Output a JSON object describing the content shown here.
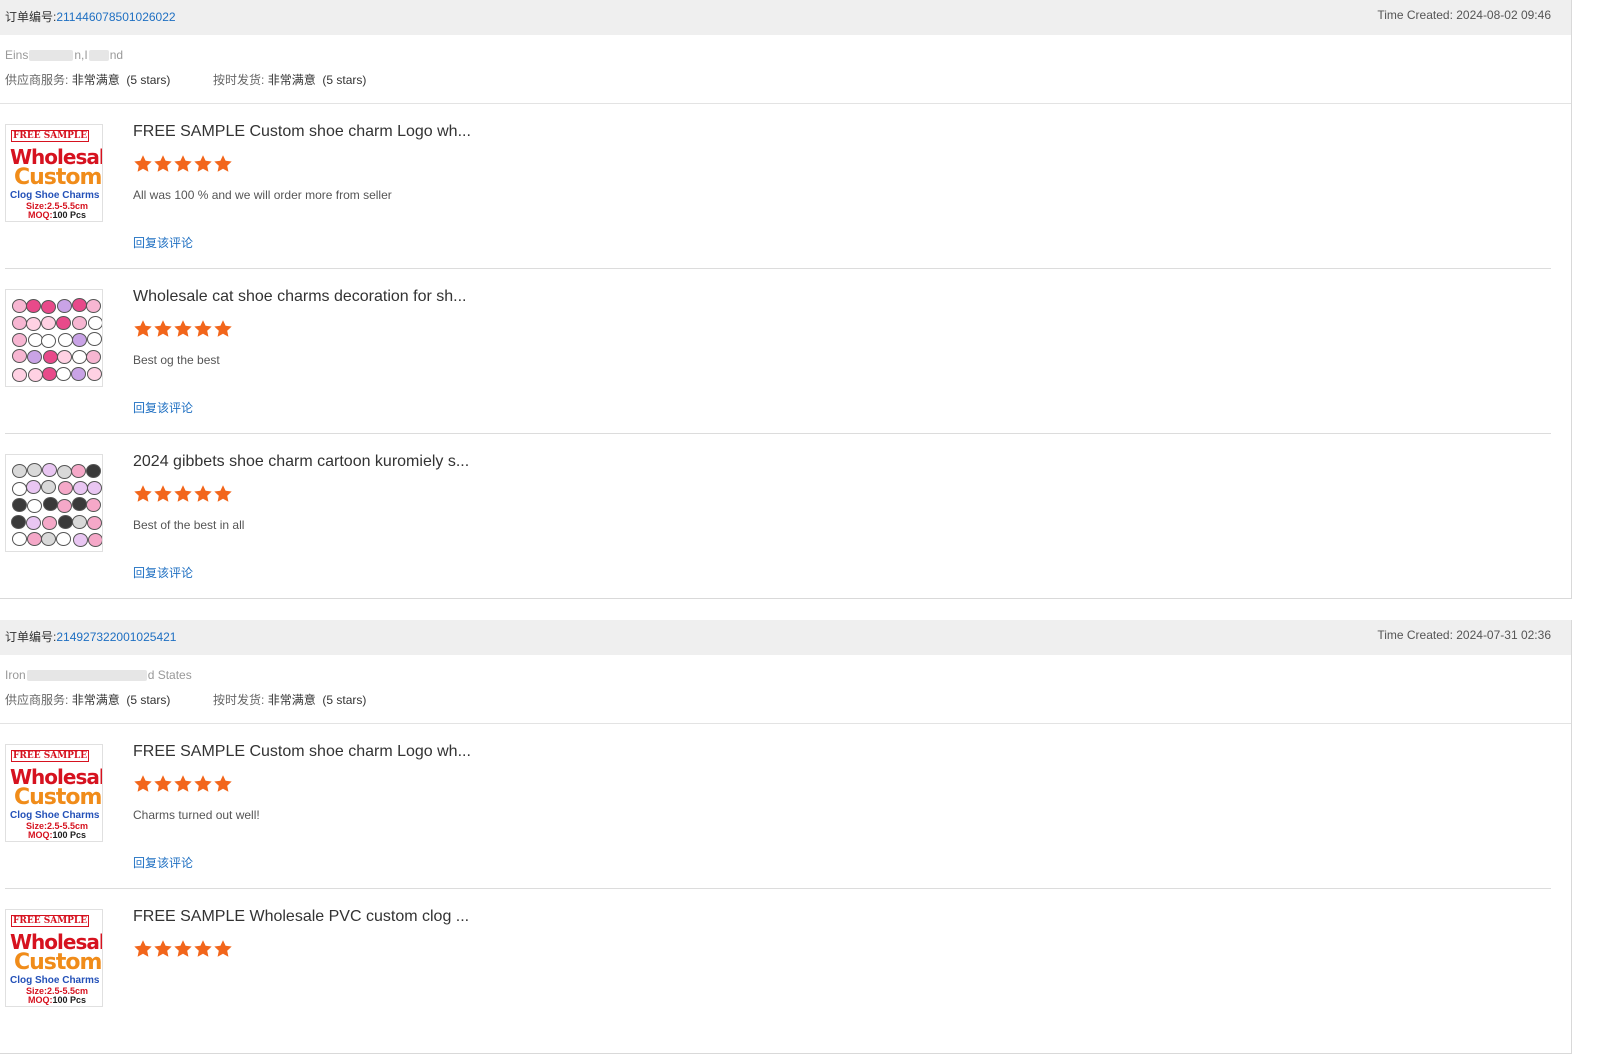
{
  "orders": [
    {
      "order_label": "订单编号:",
      "order_no": "211446078501026022",
      "time_created": "Time Created: 2024-08-02 09:46",
      "buyer_location_start": "Eins",
      "buyer_location_mid": "n,I",
      "buyer_location_end": "nd",
      "supplier_service_label": "供应商服务:",
      "supplier_service_value": "非常满意",
      "supplier_service_stars": "(5 stars)",
      "on_time_label": "按时发货:",
      "on_time_value": "非常满意",
      "on_time_stars": "(5 stars)",
      "items": [
        {
          "title": "FREE SAMPLE Custom shoe charm Logo wh...",
          "rating": 5,
          "comment": "All was 100 % and we will order more from seller",
          "reply": "回复该评论",
          "thumb": "wholesale-custom"
        },
        {
          "title": "Wholesale cat shoe charms decoration for sh...",
          "rating": 5,
          "comment": "Best og the best",
          "reply": "回复该评论",
          "thumb": "cat-charms"
        },
        {
          "title": "2024 gibbets shoe charm cartoon kuromiely s...",
          "rating": 5,
          "comment": "Best of the best in all",
          "reply": "回复该评论",
          "thumb": "kuromi-charms"
        }
      ]
    },
    {
      "order_label": "订单编号:",
      "order_no": "214927322001025421",
      "time_created": "Time Created: 2024-07-31 02:36",
      "buyer_location_start": "Iron",
      "buyer_location_mid": "",
      "buyer_location_end": "d States",
      "supplier_service_label": "供应商服务:",
      "supplier_service_value": "非常满意",
      "supplier_service_stars": "(5 stars)",
      "on_time_label": "按时发货:",
      "on_time_value": "非常满意",
      "on_time_stars": "(5 stars)",
      "items": [
        {
          "title": "FREE SAMPLE Custom shoe charm Logo wh...",
          "rating": 5,
          "comment": "Charms turned out well!",
          "reply": "回复该评论",
          "thumb": "wholesale-custom"
        },
        {
          "title": "FREE SAMPLE Wholesale PVC custom clog ...",
          "rating": 5,
          "comment": "",
          "reply": "",
          "thumb": "wholesale-custom"
        }
      ]
    }
  ],
  "thumb_text": {
    "free": "FREE SAMPLE",
    "wholesale": "Wholesale",
    "custom": "Custom",
    "clog": "Clog Shoe Charms",
    "size": "Size:2.5-5.5cm",
    "moq_label": "MOQ:",
    "moq_value": "100 Pcs"
  },
  "colors": {
    "link": "#1e6fc2",
    "star": "#f2661b",
    "header_bg": "#efefef"
  }
}
